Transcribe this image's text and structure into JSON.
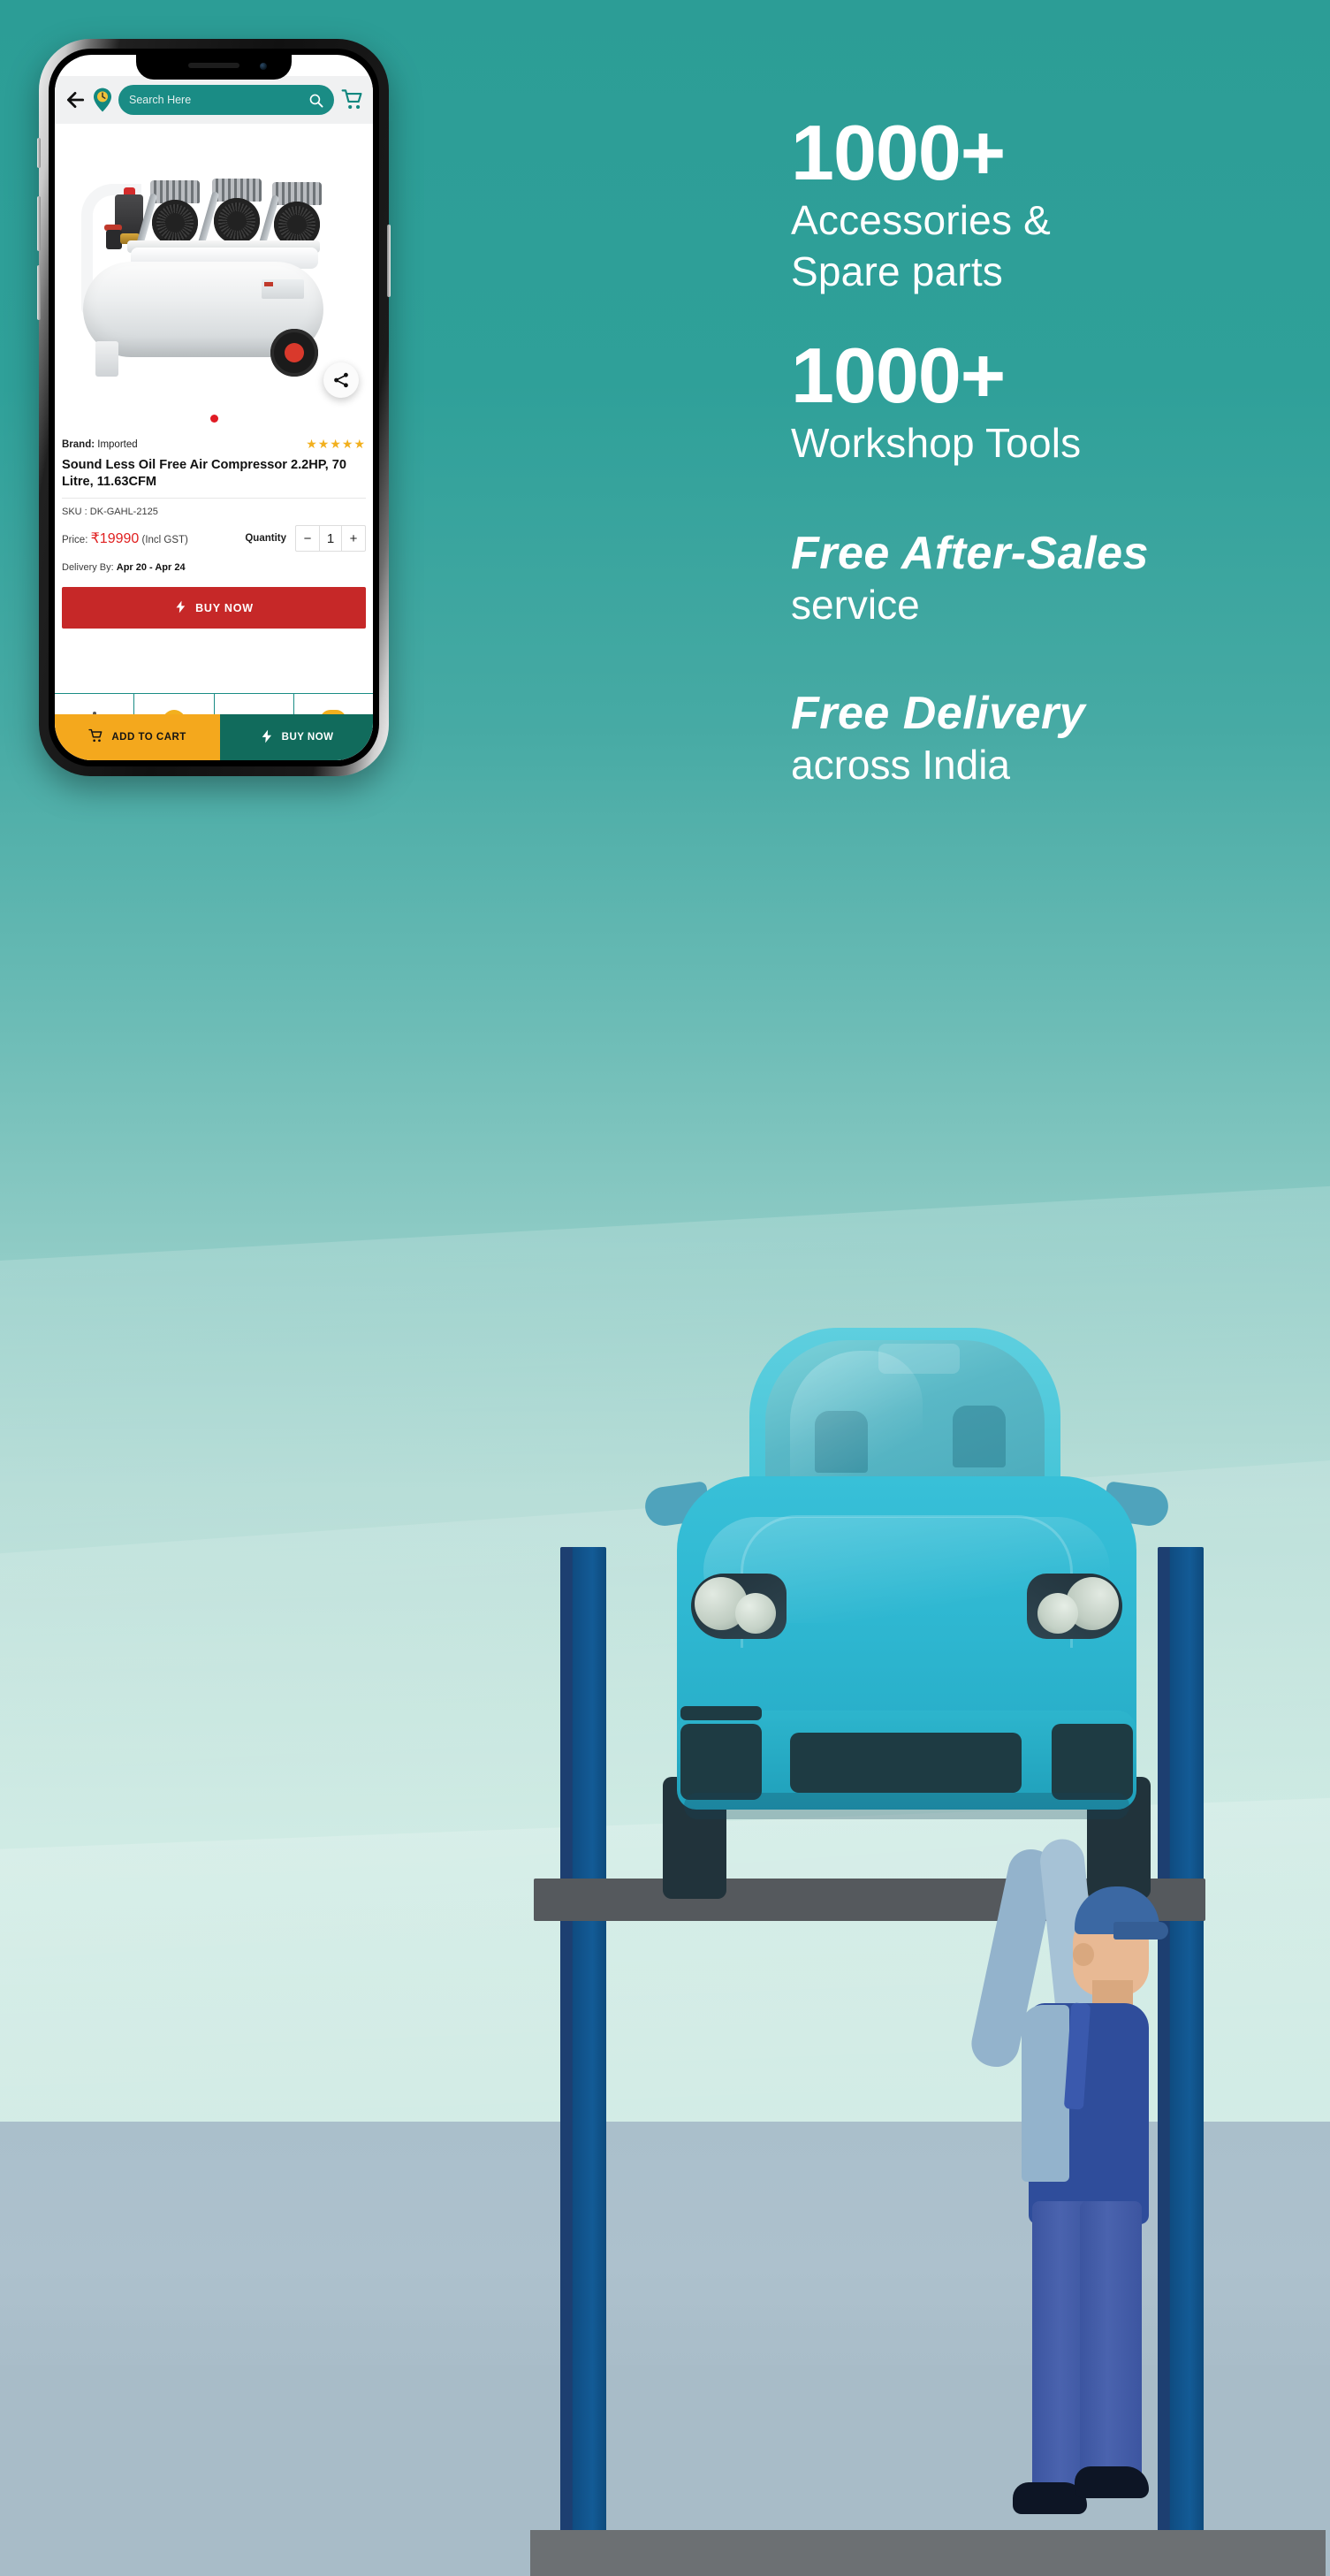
{
  "theme": {
    "brand_teal": "#2c9d96",
    "search_teal": "#1a8c85",
    "buy_now_red": "#c62828",
    "cart_amber": "#f4a81d",
    "buy_now_green": "#116b5c",
    "price_red": "#e02020",
    "star_gold": "#f2b01e",
    "dot_red": "#e01b24"
  },
  "phone": {
    "app_bar": {
      "back_icon": "back-arrow-icon",
      "location_icon": "location-pin-icon",
      "search_placeholder": "Search Here",
      "search_icon": "search-icon",
      "cart_icon": "shopping-cart-icon"
    },
    "gallery": {
      "product_image_alt": "Sound Less Oil Free Air Compressor",
      "share_icon": "share-icon",
      "dot_count": 1,
      "active_dot_index": 0
    },
    "product": {
      "brand_label": "Brand:",
      "brand_value": "Imported",
      "rating_stars": "★★★★★",
      "rating_value": 5,
      "title": "Sound Less Oil Free Air Compressor 2.2HP, 70 Litre, 11.63CFM",
      "sku_text": "SKU : DK-GAHL-2125",
      "price_label": "Price:",
      "price_value": "₹19990",
      "price_suffix": "(Incl GST)",
      "quantity_label": "Quantity",
      "quantity_minus": "−",
      "quantity_value": "1",
      "quantity_plus": "+",
      "delivery_label": "Delivery By:",
      "delivery_value": "Apr 20 - Apr 24"
    },
    "primary_button": {
      "label": "BUY NOW",
      "icon": "lightning-bolt-icon"
    },
    "bottom_bar": {
      "add_to_cart_label": "ADD TO CART",
      "add_to_cart_icon": "shopping-cart-icon",
      "buy_now_label": "BUY NOW",
      "buy_now_icon": "lightning-bolt-icon"
    }
  },
  "marketing": {
    "blocks": [
      {
        "count": "1000+",
        "line1": "Accessories &",
        "line2": "Spare parts"
      },
      {
        "count": "1000+",
        "line1": "Workshop Tools",
        "line2": ""
      }
    ],
    "after_sales": {
      "headline": "Free After-Sales",
      "subline": "service"
    },
    "delivery": {
      "headline": "Free Delivery",
      "subline": "across India"
    }
  },
  "illustration": {
    "scene_name": "car-on-two-post-lift-with-mechanic",
    "car_color": "#2fb8d2",
    "lift_post_color": "#0f4c81",
    "mechanic_uniform_color": "#2f4d9b",
    "floor_color": "#aabfcb"
  }
}
